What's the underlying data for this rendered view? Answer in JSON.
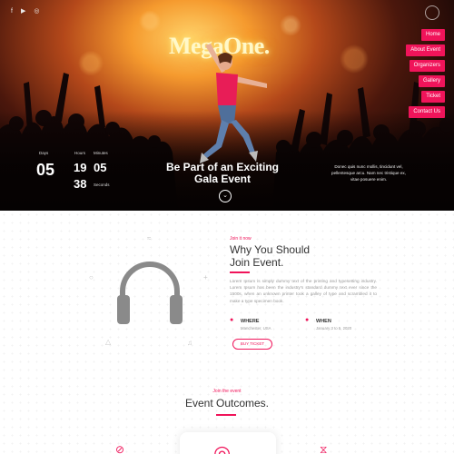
{
  "social": [
    "f",
    "▶",
    "◎"
  ],
  "nav": [
    "Home",
    "About Event",
    "Organizers",
    "Gallery",
    "Ticket",
    "Contact Us"
  ],
  "brand": {
    "logo": "MegaOne."
  },
  "countdown": {
    "days_label": "Days",
    "days": "05",
    "hours_label": "Hours",
    "hours": "19",
    "minutes_label": "Minutes",
    "minutes": "05",
    "seconds_label": "Seconds",
    "seconds": "38"
  },
  "hero": {
    "title_line1": "Be Part of an Exciting",
    "title_line2": "Gala Event",
    "description": "Donec quis nunc mollis, tincidunt vel, pellentesque arcu. Nam nec tristique ex, vitae posuere enim."
  },
  "about": {
    "eyebrow": "Join it now",
    "title_line1": "Why You Should",
    "title_line2": "Join Event.",
    "body": "Lorem Ipsum is simply dummy text of the printing and typesetting industry. Lorem Ipsum has been the industry's standard dummy text ever since the 1500s, when an unknown printer took a galley of type and scrambled it to make a type specimen book.",
    "where_title": "WHERE",
    "where_value": "Manchester, USA",
    "when_title": "WHEN",
    "when_value": "January 3 to 5, 2020",
    "buy_label": "BUY TICKET"
  },
  "outcomes": {
    "eyebrow": "Join the event",
    "title": "Event Outcomes."
  },
  "colors": {
    "accent": "#f0145a",
    "heading": "#333333",
    "muted": "#999999"
  }
}
